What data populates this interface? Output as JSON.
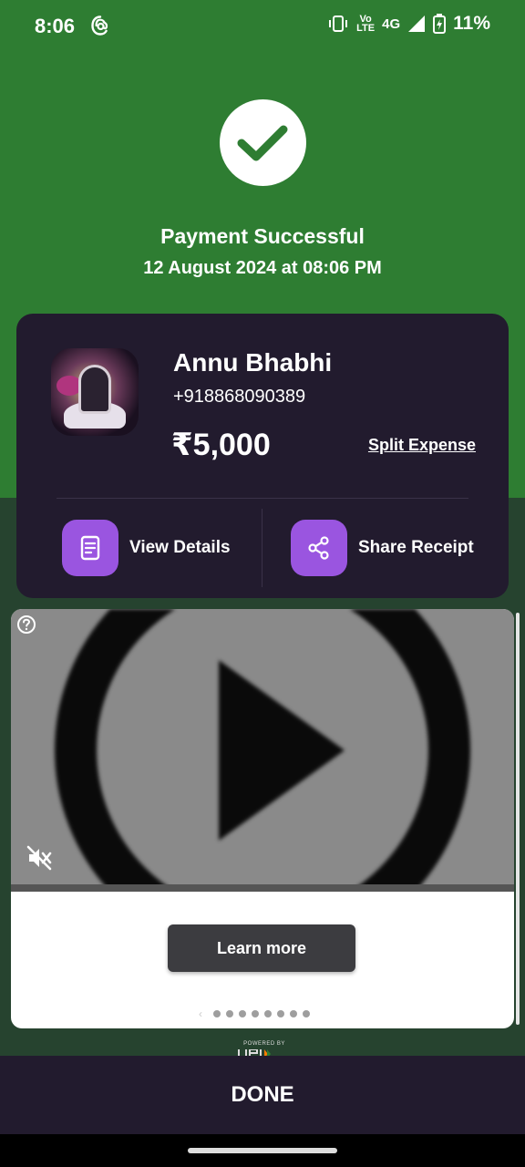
{
  "status_bar": {
    "time": "8:06",
    "volte_top": "Vo",
    "volte_bottom": "LTE",
    "network": "4G",
    "battery": "11%"
  },
  "header": {
    "title": "Payment Successful",
    "datetime": "12 August 2024 at 08:06 PM"
  },
  "payee": {
    "name": "Annu Bhabhi",
    "phone": "+918868090389",
    "amount": "₹5,000",
    "split_label": "Split Expense"
  },
  "actions": {
    "view_details": "View Details",
    "share_receipt": "Share Receipt"
  },
  "ad": {
    "learn_more": "Learn more",
    "carousel_pages": 8
  },
  "footer": {
    "powered_by": "POWERED BY",
    "done": "DONE"
  },
  "colors": {
    "success_green": "#2e7d32",
    "card_bg": "#221b2e",
    "accent_purple": "#9a55e0"
  }
}
